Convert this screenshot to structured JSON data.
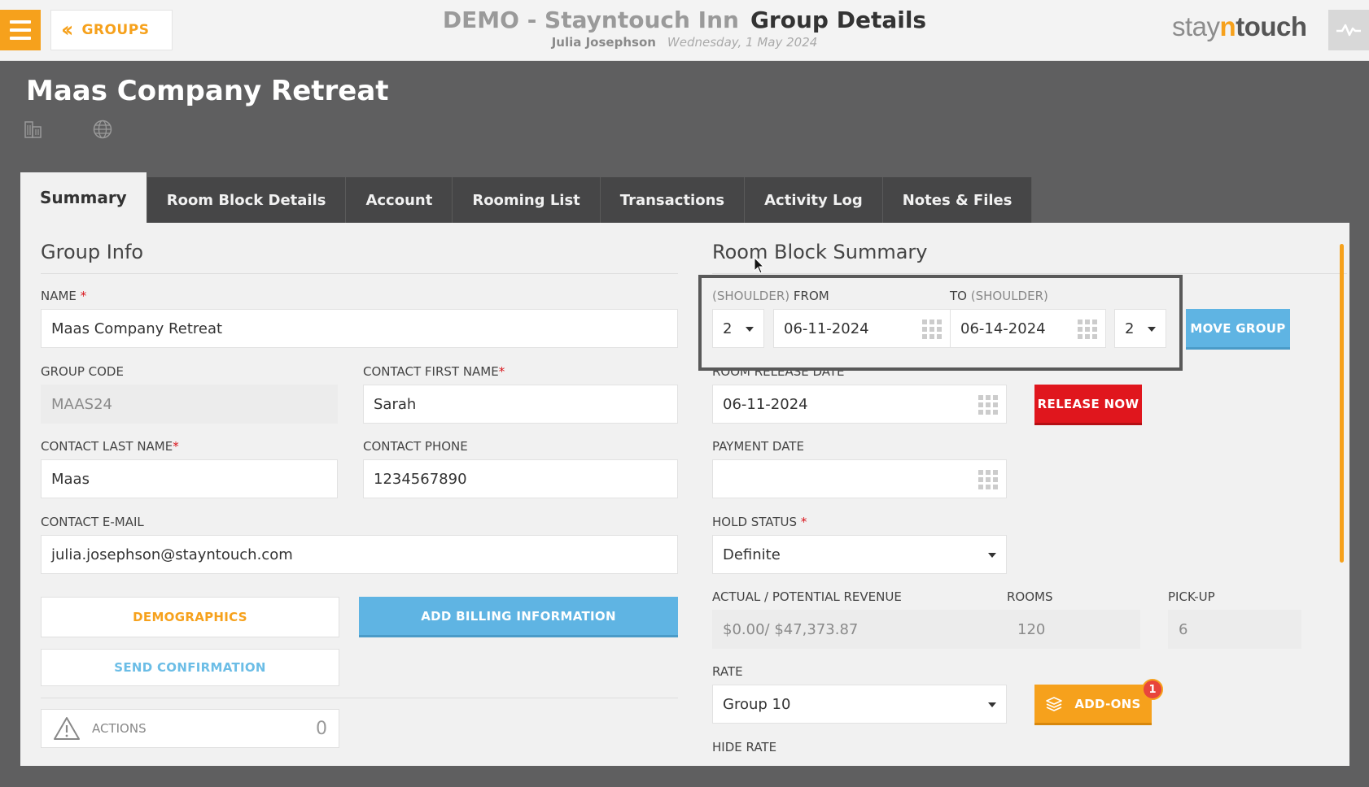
{
  "header": {
    "back_label": "GROUPS",
    "hotel_name": "DEMO - Stayntouch Inn",
    "page_title": "Group Details",
    "user_name": "Julia Josephson",
    "date": "Wednesday, 1 May 2024",
    "brand_pre": "stay",
    "brand_n": "n",
    "brand_post": "touch"
  },
  "group": {
    "title": "Maas Company Retreat"
  },
  "tabs": [
    {
      "label": "Summary",
      "active": true
    },
    {
      "label": "Room Block Details"
    },
    {
      "label": "Account"
    },
    {
      "label": "Rooming List"
    },
    {
      "label": "Transactions"
    },
    {
      "label": "Activity Log"
    },
    {
      "label": "Notes & Files"
    }
  ],
  "group_info": {
    "title": "Group Info",
    "name_label": "NAME",
    "name_value": "Maas Company Retreat",
    "code_label": "GROUP CODE",
    "code_value": "MAAS24",
    "first_name_label": "CONTACT FIRST NAME",
    "first_name_value": "Sarah",
    "last_name_label": "CONTACT LAST NAME",
    "last_name_value": "Maas",
    "phone_label": "CONTACT PHONE",
    "phone_value": "1234567890",
    "email_label": "CONTACT E-MAIL",
    "email_value": "julia.josephson@stayntouch.com",
    "demographics_label": "DEMOGRAPHICS",
    "billing_label": "ADD BILLING INFORMATION",
    "confirmation_label": "SEND CONFIRMATION",
    "actions_label": "ACTIONS",
    "actions_count": "0",
    "required_mark": "*"
  },
  "room_block": {
    "title": "Room Block Summary",
    "from_shoulder": "(SHOULDER)",
    "from_label": "FROM",
    "to_label": "TO",
    "to_shoulder": "(SHOULDER)",
    "from_shoulder_value": "2",
    "from_date": "06-11-2024",
    "to_date": "06-14-2024",
    "to_shoulder_value": "2",
    "move_group_label": "MOVE GROUP",
    "release_label": "ROOM RELEASE DATE",
    "release_date": "06-11-2024",
    "release_now_label": "RELEASE NOW",
    "payment_label": "PAYMENT DATE",
    "payment_value": "",
    "hold_label": "HOLD STATUS",
    "hold_value": "Definite",
    "revenue_label": "ACTUAL / POTENTIAL REVENUE",
    "revenue_value": "$0.00/ $47,373.87",
    "rooms_label": "ROOMS",
    "rooms_value": "120",
    "pickup_label": "PICK-UP",
    "pickup_value": "6",
    "rate_label": "RATE",
    "rate_value": "Group 10",
    "addons_label": "ADD-ONS",
    "addons_badge": "1",
    "hide_rate_label": "HIDE RATE"
  },
  "colors": {
    "accent": "#f6a11c",
    "blue": "#5fb4e3",
    "red": "#e0161d",
    "banner": "#5f5f60",
    "tab_bg": "#464647"
  }
}
